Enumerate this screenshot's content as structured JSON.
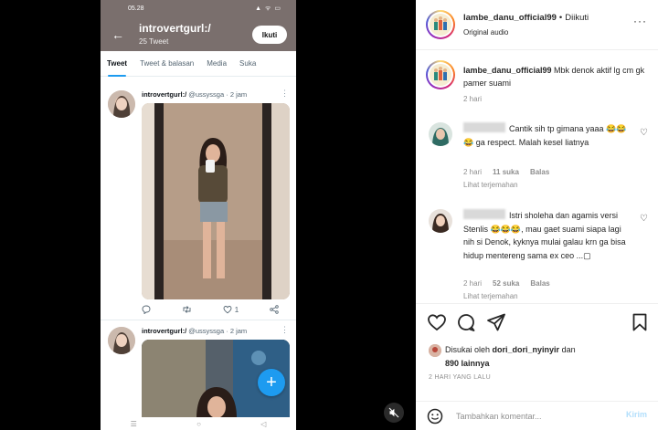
{
  "phone": {
    "status_time": "05.28",
    "status_icons": "▲ ᯤ ▭",
    "profile_name": "introvertgurl:/",
    "tweet_count": "25 Tweet",
    "follow_label": "Ikuti",
    "tabs": [
      {
        "label": "Tweet",
        "active": true
      },
      {
        "label": "Tweet & balasan",
        "active": false
      },
      {
        "label": "Media",
        "active": false
      },
      {
        "label": "Suka",
        "active": false
      }
    ],
    "tweets": [
      {
        "name": "introvertgurl:/",
        "handle": "@ussyssga",
        "time": "· 2 jam",
        "like_count": "1"
      },
      {
        "name": "introvertgurl:/",
        "handle": "@ussyssga",
        "time": "· 2 jam"
      }
    ],
    "nav_icons": [
      "☰",
      "○",
      "◁"
    ]
  },
  "panel": {
    "username": "lambe_danu_official99",
    "follow_state": "Diikuti",
    "audio": "Original audio",
    "caption": {
      "username": "lambe_danu_official99",
      "text": " Mbk denok aktif lg cm gk pamer suami",
      "time": "2 hari"
    },
    "comments": [
      {
        "text": "Cantik sih tp gimana yaaa 😂😂😂 ga respect. Malah kesel liatnya",
        "time": "2 hari",
        "likes": "11 suka",
        "reply": "Balas",
        "translate": "Lihat terjemahan"
      },
      {
        "text": "Istri sholeha dan agamis versi Stenlis 😂😂😂, mau gaet suami siapa lagi nih si Denok, kyknya mulai galau krn ga bisa hidup mentereng sama ex ceo ...▢",
        "time": "2 hari",
        "likes": "52 suka",
        "reply": "Balas",
        "translate": "Lihat terjemahan"
      }
    ],
    "liked_by_prefix": "Disukai oleh ",
    "liked_by_user": "dori_dori_nyinyir",
    "liked_by_mid": " dan ",
    "liked_by_count": "890 lainnya",
    "date": "2 HARI YANG LALU",
    "comment_placeholder": "Tambahkan komentar...",
    "post_label": "Kirim"
  },
  "colors": {
    "twitter_blue": "#1d9bf0",
    "twitter_header": "#7a6f6d",
    "ig_muted": "#8e8e8e",
    "ig_post_disabled": "#b2dffc"
  }
}
